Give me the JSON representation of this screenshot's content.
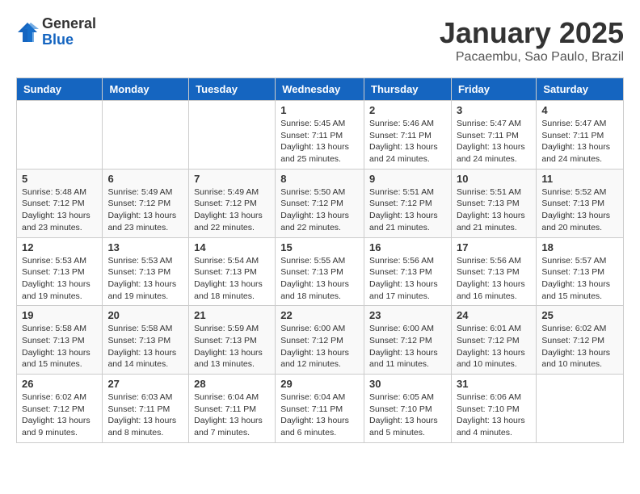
{
  "logo": {
    "general": "General",
    "blue": "Blue"
  },
  "header": {
    "month": "January 2025",
    "location": "Pacaembu, Sao Paulo, Brazil"
  },
  "weekdays": [
    "Sunday",
    "Monday",
    "Tuesday",
    "Wednesday",
    "Thursday",
    "Friday",
    "Saturday"
  ],
  "weeks": [
    [
      {
        "day": "",
        "info": ""
      },
      {
        "day": "",
        "info": ""
      },
      {
        "day": "",
        "info": ""
      },
      {
        "day": "1",
        "info": "Sunrise: 5:45 AM\nSunset: 7:11 PM\nDaylight: 13 hours\nand 25 minutes."
      },
      {
        "day": "2",
        "info": "Sunrise: 5:46 AM\nSunset: 7:11 PM\nDaylight: 13 hours\nand 24 minutes."
      },
      {
        "day": "3",
        "info": "Sunrise: 5:47 AM\nSunset: 7:11 PM\nDaylight: 13 hours\nand 24 minutes."
      },
      {
        "day": "4",
        "info": "Sunrise: 5:47 AM\nSunset: 7:11 PM\nDaylight: 13 hours\nand 24 minutes."
      }
    ],
    [
      {
        "day": "5",
        "info": "Sunrise: 5:48 AM\nSunset: 7:12 PM\nDaylight: 13 hours\nand 23 minutes."
      },
      {
        "day": "6",
        "info": "Sunrise: 5:49 AM\nSunset: 7:12 PM\nDaylight: 13 hours\nand 23 minutes."
      },
      {
        "day": "7",
        "info": "Sunrise: 5:49 AM\nSunset: 7:12 PM\nDaylight: 13 hours\nand 22 minutes."
      },
      {
        "day": "8",
        "info": "Sunrise: 5:50 AM\nSunset: 7:12 PM\nDaylight: 13 hours\nand 22 minutes."
      },
      {
        "day": "9",
        "info": "Sunrise: 5:51 AM\nSunset: 7:12 PM\nDaylight: 13 hours\nand 21 minutes."
      },
      {
        "day": "10",
        "info": "Sunrise: 5:51 AM\nSunset: 7:13 PM\nDaylight: 13 hours\nand 21 minutes."
      },
      {
        "day": "11",
        "info": "Sunrise: 5:52 AM\nSunset: 7:13 PM\nDaylight: 13 hours\nand 20 minutes."
      }
    ],
    [
      {
        "day": "12",
        "info": "Sunrise: 5:53 AM\nSunset: 7:13 PM\nDaylight: 13 hours\nand 19 minutes."
      },
      {
        "day": "13",
        "info": "Sunrise: 5:53 AM\nSunset: 7:13 PM\nDaylight: 13 hours\nand 19 minutes."
      },
      {
        "day": "14",
        "info": "Sunrise: 5:54 AM\nSunset: 7:13 PM\nDaylight: 13 hours\nand 18 minutes."
      },
      {
        "day": "15",
        "info": "Sunrise: 5:55 AM\nSunset: 7:13 PM\nDaylight: 13 hours\nand 18 minutes."
      },
      {
        "day": "16",
        "info": "Sunrise: 5:56 AM\nSunset: 7:13 PM\nDaylight: 13 hours\nand 17 minutes."
      },
      {
        "day": "17",
        "info": "Sunrise: 5:56 AM\nSunset: 7:13 PM\nDaylight: 13 hours\nand 16 minutes."
      },
      {
        "day": "18",
        "info": "Sunrise: 5:57 AM\nSunset: 7:13 PM\nDaylight: 13 hours\nand 15 minutes."
      }
    ],
    [
      {
        "day": "19",
        "info": "Sunrise: 5:58 AM\nSunset: 7:13 PM\nDaylight: 13 hours\nand 15 minutes."
      },
      {
        "day": "20",
        "info": "Sunrise: 5:58 AM\nSunset: 7:13 PM\nDaylight: 13 hours\nand 14 minutes."
      },
      {
        "day": "21",
        "info": "Sunrise: 5:59 AM\nSunset: 7:13 PM\nDaylight: 13 hours\nand 13 minutes."
      },
      {
        "day": "22",
        "info": "Sunrise: 6:00 AM\nSunset: 7:12 PM\nDaylight: 13 hours\nand 12 minutes."
      },
      {
        "day": "23",
        "info": "Sunrise: 6:00 AM\nSunset: 7:12 PM\nDaylight: 13 hours\nand 11 minutes."
      },
      {
        "day": "24",
        "info": "Sunrise: 6:01 AM\nSunset: 7:12 PM\nDaylight: 13 hours\nand 10 minutes."
      },
      {
        "day": "25",
        "info": "Sunrise: 6:02 AM\nSunset: 7:12 PM\nDaylight: 13 hours\nand 10 minutes."
      }
    ],
    [
      {
        "day": "26",
        "info": "Sunrise: 6:02 AM\nSunset: 7:12 PM\nDaylight: 13 hours\nand 9 minutes."
      },
      {
        "day": "27",
        "info": "Sunrise: 6:03 AM\nSunset: 7:11 PM\nDaylight: 13 hours\nand 8 minutes."
      },
      {
        "day": "28",
        "info": "Sunrise: 6:04 AM\nSunset: 7:11 PM\nDaylight: 13 hours\nand 7 minutes."
      },
      {
        "day": "29",
        "info": "Sunrise: 6:04 AM\nSunset: 7:11 PM\nDaylight: 13 hours\nand 6 minutes."
      },
      {
        "day": "30",
        "info": "Sunrise: 6:05 AM\nSunset: 7:10 PM\nDaylight: 13 hours\nand 5 minutes."
      },
      {
        "day": "31",
        "info": "Sunrise: 6:06 AM\nSunset: 7:10 PM\nDaylight: 13 hours\nand 4 minutes."
      },
      {
        "day": "",
        "info": ""
      }
    ]
  ]
}
